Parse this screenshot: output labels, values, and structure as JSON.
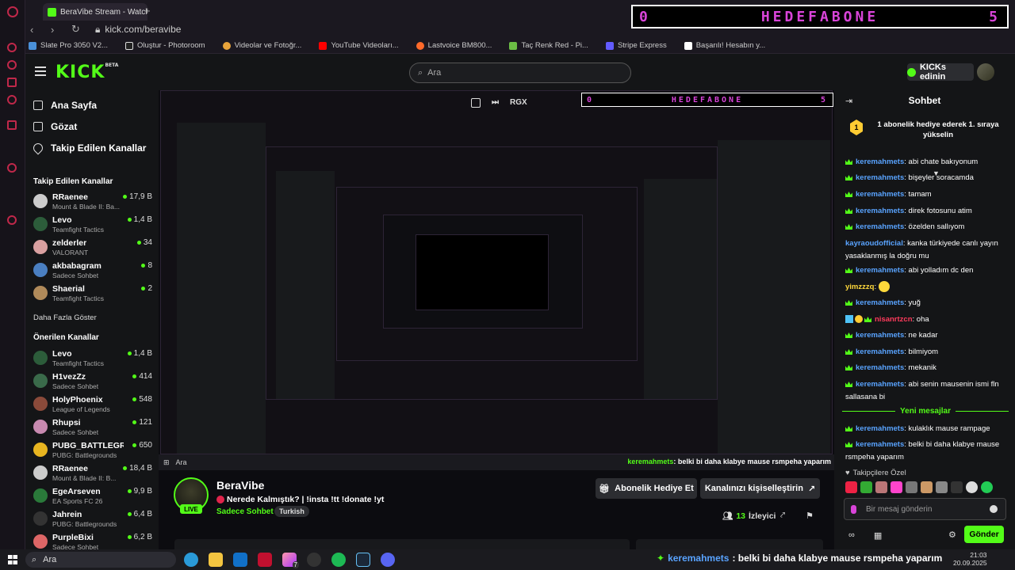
{
  "browser": {
    "tab_title": "BeraVibe Stream - Watch",
    "url": "kick.com/beravibe",
    "bookmarks": [
      "Slate Pro 3050 V2...",
      "Oluştur - Photoroom",
      "Videolar ve Fotoğr...",
      "YouTube Videoları...",
      "Lastvoice BM800...",
      "Taç Renk Red - Pi...",
      "Stripe Express",
      "Başarılı! Hesabın y..."
    ]
  },
  "overlay": {
    "left": "0",
    "title": "HEDEFABONE",
    "right": "5"
  },
  "header": {
    "logo": "KICK",
    "logo_badge": "BETA",
    "search_placeholder": "Ara",
    "kicks_button": "KICKs edinin"
  },
  "sidebar": {
    "nav": [
      "Ana Sayfa",
      "Gözat",
      "Takip Edilen Kanallar"
    ],
    "followed_title": "Takip Edilen Kanallar",
    "followed": [
      {
        "name": "RRaenee",
        "game": "Mount & Blade II: Ba...",
        "viewers": "17,9 B"
      },
      {
        "name": "Levo",
        "game": "Teamfight Tactics",
        "viewers": "1,4 B"
      },
      {
        "name": "zelderler",
        "game": "VALORANT",
        "viewers": "34"
      },
      {
        "name": "akbabagram",
        "game": "Sadece Sohbet",
        "viewers": "8"
      },
      {
        "name": "Shaerial",
        "game": "Teamfight Tactics",
        "viewers": "2"
      }
    ],
    "show_more": "Daha Fazla Göster",
    "recommended_title": "Önerilen Kanallar",
    "recommended": [
      {
        "name": "Levo",
        "game": "Teamfight Tactics",
        "viewers": "1,4 B"
      },
      {
        "name": "H1vezZz",
        "game": "Sadece Sohbet",
        "viewers": "414"
      },
      {
        "name": "HolyPhoenix",
        "game": "League of Legends",
        "viewers": "548"
      },
      {
        "name": "Rhupsi",
        "game": "Sadece Sohbet",
        "viewers": "121"
      },
      {
        "name": "PUBG_BATTLEGR...",
        "game": "PUBG: Battlegrounds",
        "viewers": "650"
      },
      {
        "name": "RRaenee",
        "game": "Mount & Blade II: B...",
        "viewers": "18,4 B"
      },
      {
        "name": "EgeArseven",
        "game": "EA Sports FC 26",
        "viewers": "9,9 B"
      },
      {
        "name": "Jahrein",
        "game": "PUBG: Battlegrounds",
        "viewers": "6,4 B"
      },
      {
        "name": "PurpleBixi",
        "game": "Sadece Sohbet",
        "viewers": "6,2 B"
      }
    ]
  },
  "video": {
    "ctrl_label": "RGX"
  },
  "stream": {
    "streamer": "BeraVibe",
    "live_label": "LIVE",
    "title": "Nerede Kalmıştık? | !insta !tt !donate !yt",
    "category": "Sadece Sohbet",
    "tag": "Turkish",
    "gift_button": "Abonelik Hediye Et",
    "customize_button": "Kanalınızı kişiselleştirin",
    "viewer_count": "13",
    "viewer_label": "İzleyici"
  },
  "chat": {
    "title": "Sohbet",
    "pinned_count": "1",
    "pinned_text": "1 abonelik hediye ederek 1. sıraya yükselin",
    "messages": [
      {
        "user": "keremahmets",
        "text": "abi chate bakıyonum"
      },
      {
        "user": "keremahmets",
        "text": "bişeyler soracamda"
      },
      {
        "user": "keremahmets",
        "text": "tamam"
      },
      {
        "user": "keremahmets",
        "text": "direk fotosunu atim"
      },
      {
        "user": "keremahmets",
        "text": "özelden sallıyom"
      },
      {
        "user": "kayraoudofficial",
        "text": "kanka türkiyede canlı yayın yasaklanmış la doğru mu"
      },
      {
        "user": "keremahmets",
        "text": "abi yolladım dc den"
      },
      {
        "user": "yimzzzq",
        "text": ""
      },
      {
        "user": "keremahmets",
        "text": "yuğ"
      },
      {
        "user": "nisanrtzcn",
        "text": "oha"
      },
      {
        "user": "keremahmets",
        "text": "ne kadar"
      },
      {
        "user": "keremahmets",
        "text": "bilmiyom"
      },
      {
        "user": "keremahmets",
        "text": "mekanik"
      },
      {
        "user": "keremahmets",
        "text": "abi senin mausenin ismi fln sallasana bi"
      }
    ],
    "new_messages_label": "Yeni mesajlar",
    "new_messages": [
      {
        "user": "keremahmets",
        "text": "kulaklık mause rampage"
      },
      {
        "user": "keremahmets",
        "text": "belki bi daha klabye mause rsmpeha yaparım"
      }
    ],
    "subscribers_label": "Takipçilere Özel",
    "input_placeholder": "Bir mesaj gönderin",
    "send_button": "Gönder"
  },
  "taskbar": {
    "search_placeholder": "Ara",
    "ticker_user": "keremahmets",
    "ticker_text": ": belki bi daha klabye mause rsmpeha yaparım",
    "time": "21:03",
    "date": "20.09.2025",
    "badge_count": "7"
  }
}
